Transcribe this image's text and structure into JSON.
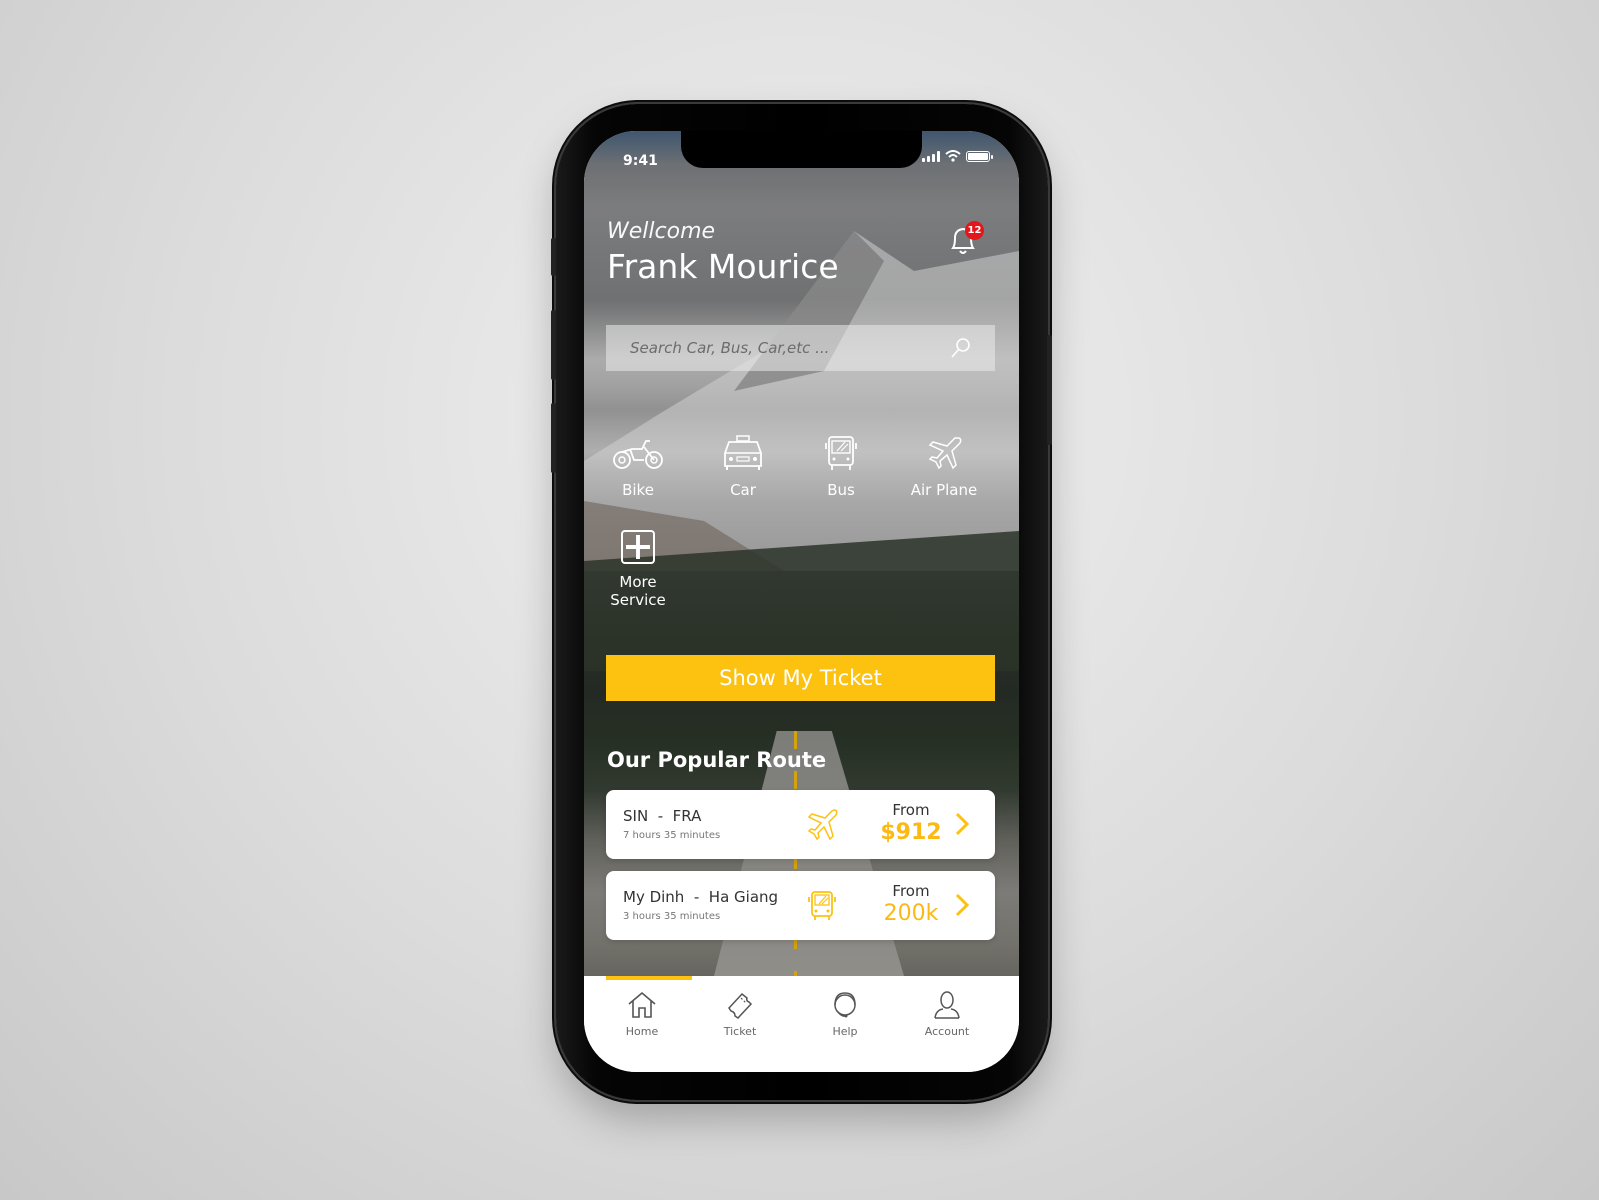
{
  "status_bar": {
    "time": "9:41"
  },
  "header": {
    "greeting": "Wellcome",
    "user_name": "Frank Mourice",
    "notification_count": "12"
  },
  "search": {
    "placeholder": "Search Car, Bus, Car,etc ..."
  },
  "services": [
    {
      "label": "Bike",
      "icon": "motorbike-icon"
    },
    {
      "label": "Car",
      "icon": "taxi-icon"
    },
    {
      "label": "Bus",
      "icon": "bus-icon"
    },
    {
      "label": "Air Plane",
      "icon": "airplane-icon"
    },
    {
      "label": "More\nService",
      "icon": "plus-box-icon"
    }
  ],
  "primary_action": {
    "label": "Show My Ticket"
  },
  "popular": {
    "title": "Our Popular Route",
    "routes": [
      {
        "from_city": "SIN",
        "to_city": "FRA",
        "cities": "SIN  -  FRA",
        "duration": "7 hours 35 minutes",
        "mode_icon": "airplane-icon",
        "from_label": "From",
        "price": "$912"
      },
      {
        "from_city": "My Dinh",
        "to_city": "Ha Giang",
        "cities": "My Dinh  -  Ha Giang",
        "duration": "3 hours 35 minutes",
        "mode_icon": "bus-icon",
        "from_label": "From",
        "price": "200k"
      }
    ]
  },
  "tabbar": {
    "active": "Home",
    "items": [
      {
        "label": "Home",
        "icon": "home-icon"
      },
      {
        "label": "Ticket",
        "icon": "ticket-icon"
      },
      {
        "label": "Help",
        "icon": "headset-icon"
      },
      {
        "label": "Account",
        "icon": "user-icon"
      }
    ]
  },
  "colors": {
    "accent": "#fdc10f",
    "price": "#fdb913",
    "badge": "#e3161b"
  }
}
